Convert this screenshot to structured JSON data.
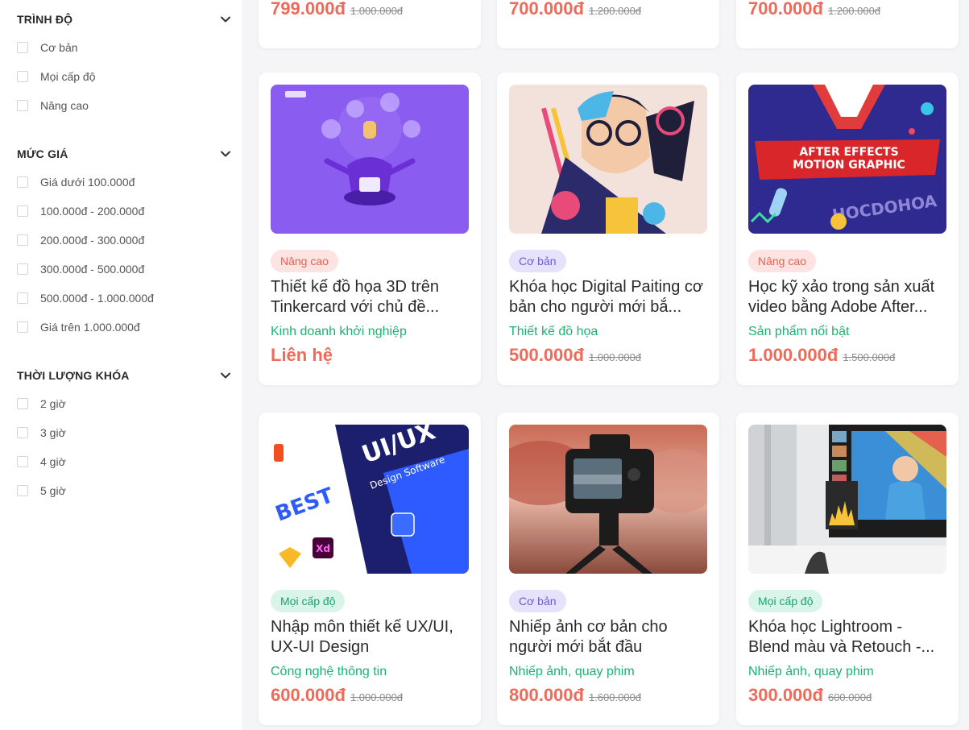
{
  "filters": [
    {
      "title": "TRÌNH ĐỘ",
      "options": [
        "Cơ bản",
        "Mọi cấp độ",
        "Nâng cao"
      ]
    },
    {
      "title": "MỨC GIÁ",
      "options": [
        "Giá dưới 100.000đ",
        "100.000đ - 200.000đ",
        "200.000đ - 300.000đ",
        "300.000đ - 500.000đ",
        "500.000đ - 1.000.000đ",
        "Giá trên 1.000.000đ"
      ]
    },
    {
      "title": "THỜI LƯỢNG KHÓA",
      "options": [
        "2 giờ",
        "3 giờ",
        "4 giờ",
        "5 giờ"
      ]
    }
  ],
  "top_row": [
    {
      "price": "799.000đ",
      "old_price": "1.000.000đ"
    },
    {
      "price": "700.000đ",
      "old_price": "1.200.000đ"
    },
    {
      "price": "700.000đ",
      "old_price": "1.200.000đ"
    }
  ],
  "courses": [
    {
      "level": "Nâng cao",
      "title": "Thiết kế đồ họa 3D trên Tinkercard với chủ đề...",
      "category": "Kinh doanh khởi nghiệp",
      "price": "Liên hệ",
      "old_price": ""
    },
    {
      "level": "Cơ bản",
      "title": "Khóa học Digital Paiting cơ bản cho người mới bắ...",
      "category": "Thiết kế đồ họa",
      "price": "500.000đ",
      "old_price": "1.000.000đ"
    },
    {
      "level": "Nâng cao",
      "title": "Học kỹ xảo trong sản xuất video bằng Adobe After...",
      "category": "Sản phẩm nổi bật",
      "price": "1.000.000đ",
      "old_price": "1.500.000đ",
      "thumb_text_1": "AFTER EFFECTS",
      "thumb_text_2": "MOTION GRAPHIC",
      "thumb_text_3": "HOCDOHOA"
    },
    {
      "level": "Mọi cấp độ",
      "title": "Nhập môn thiết kế UX/UI, UX-UI Design",
      "category": "Công nghệ thông tin",
      "price": "600.000đ",
      "old_price": "1.000.000đ",
      "thumb_text_1": "BEST",
      "thumb_text_2": "UI/UX",
      "thumb_text_3": "Design Software",
      "thumb_text_4": "Xd"
    },
    {
      "level": "Cơ bản",
      "title": "Nhiếp ảnh cơ bản cho người mới bắt đầu",
      "category": "Nhiếp ảnh, quay phim",
      "price": "800.000đ",
      "old_price": "1.600.000đ"
    },
    {
      "level": "Mọi cấp độ",
      "title": "Khóa học Lightroom - Blend màu và Retouch -...",
      "category": "Nhiếp ảnh, quay phim",
      "price": "300.000đ",
      "old_price": "600.000đ"
    }
  ],
  "badge_colors": {
    "Nâng cao": {
      "bg": "#fde3e1",
      "fg": "#e5634f"
    },
    "Cơ bản": {
      "bg": "#e6e2fb",
      "fg": "#6b5bd6"
    },
    "Mọi cấp độ": {
      "bg": "#d9f5ea",
      "fg": "#1aa36b"
    }
  },
  "colors": {
    "price": "#ee6a5a",
    "category": "#1ab371"
  }
}
